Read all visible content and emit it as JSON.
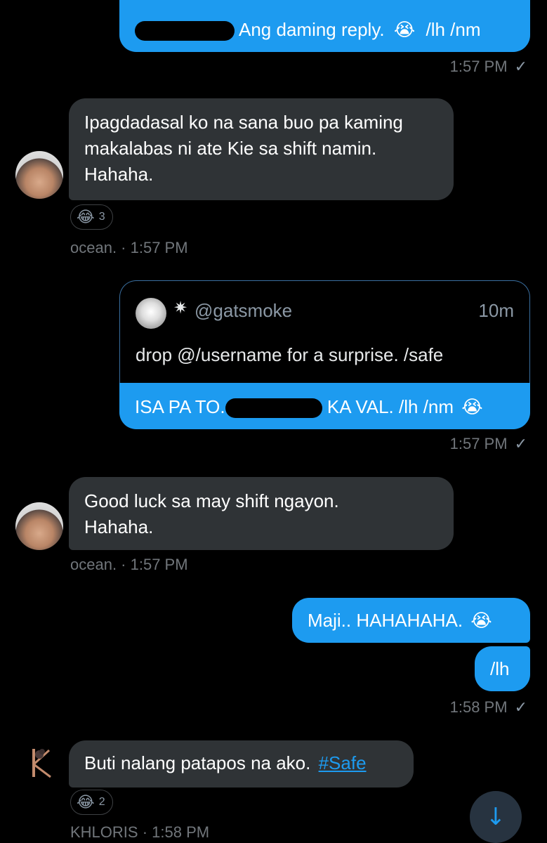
{
  "messages": {
    "m1": {
      "text_after_redaction": "Ang daming reply.",
      "emoji": "😭",
      "suffix": "/lh /nm",
      "time": "1:57 PM"
    },
    "m2": {
      "lines": [
        "Ipagdadasal ko na sana buo pa kaming",
        "makalabas ni ate Kie sa shift namin.",
        "Hahaha."
      ],
      "reaction_emoji": "😂",
      "reaction_count": "3",
      "sender_time": "ocean. · 1:57 PM"
    },
    "m3": {
      "quoted_tweet": {
        "handle": "@gatsmoke",
        "name_glyph": "✷",
        "age": "10m",
        "text": "drop @/username for a surprise. /safe"
      },
      "text_prefix": "ISA PA TO.",
      "text_after_redaction": "KA VAL. /lh /nm",
      "emoji": "😭",
      "time": "1:57 PM"
    },
    "m4": {
      "lines": [
        "Good luck sa may shift ngayon.",
        "Hahaha."
      ],
      "sender_time": "ocean. · 1:57 PM"
    },
    "m5": {
      "text": "Maji.. HAHAHAHA.",
      "emoji": "😭"
    },
    "m6": {
      "text": "/lh",
      "time": "1:58 PM"
    },
    "m7": {
      "text": "Buti nalang patapos na ako.",
      "hashtag": "#Safe",
      "reaction_emoji": "😂",
      "reaction_count": "2",
      "sender_time": "KHLORIS · 1:58 PM"
    }
  },
  "icons": {
    "read_check": "✓",
    "scroll_down": "↓"
  },
  "colors": {
    "bubble_out": "#1d9bf0",
    "bubble_in": "#2f3336",
    "link": "#1d9bf0",
    "meta": "#71767b"
  }
}
